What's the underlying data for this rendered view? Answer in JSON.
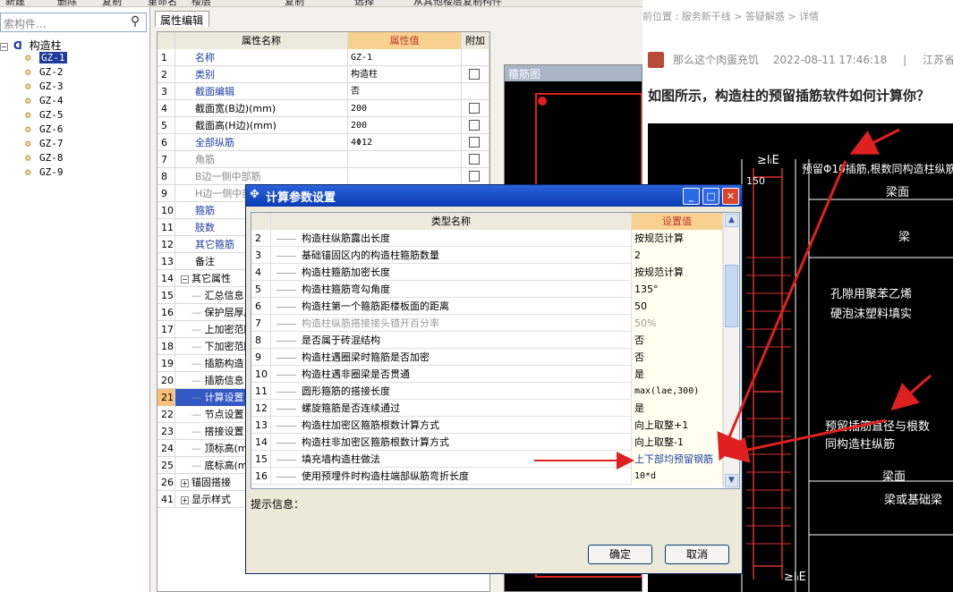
{
  "toolbar": {
    "items": [
      "新建",
      "删除",
      "复制",
      "重命名",
      "楼层",
      "",
      "复制",
      "选择",
      "从其他楼层复制构件"
    ]
  },
  "left_panel": {
    "search_placeholder": "索构件...",
    "tree_root_label": "构造柱",
    "tree_items": [
      "GZ-1",
      "GZ-2",
      "GZ-3",
      "GZ-4",
      "GZ-5",
      "GZ-6",
      "GZ-7",
      "GZ-8",
      "GZ-9"
    ],
    "selected_item": "GZ-1"
  },
  "property_editor": {
    "tab_label": "属性编辑",
    "headers": {
      "name": "属性名称",
      "value": "属性值",
      "add": "附加"
    },
    "rows": [
      {
        "num": "1",
        "name": "名称",
        "value": "GZ-1",
        "style": "blue",
        "checkbox": false
      },
      {
        "num": "2",
        "name": "类别",
        "value": "构造柱",
        "style": "blue",
        "checkbox": true
      },
      {
        "num": "3",
        "name": "截面编辑",
        "value": "否",
        "style": "blue",
        "checkbox": false
      },
      {
        "num": "4",
        "name": "截面宽(B边)(mm)",
        "value": "200",
        "style": "normal",
        "checkbox": true
      },
      {
        "num": "5",
        "name": "截面高(H边)(mm)",
        "value": "200",
        "style": "normal",
        "checkbox": true
      },
      {
        "num": "6",
        "name": "全部纵筋",
        "value": "4Φ12",
        "style": "blue",
        "checkbox": true
      },
      {
        "num": "7",
        "name": "角筋",
        "value": "",
        "style": "grey",
        "checkbox": true
      },
      {
        "num": "8",
        "name": "B边一侧中部筋",
        "value": "",
        "style": "grey",
        "checkbox": true
      },
      {
        "num": "9",
        "name": "H边一侧中部筋",
        "value": "",
        "style": "grey",
        "checkbox": true
      },
      {
        "num": "10",
        "name": "箍筋",
        "value": "",
        "style": "blue",
        "checkbox": false
      },
      {
        "num": "11",
        "name": "肢数",
        "value": "",
        "style": "blue",
        "checkbox": false
      },
      {
        "num": "12",
        "name": "其它箍筋",
        "value": "",
        "style": "blue",
        "checkbox": false
      },
      {
        "num": "13",
        "name": "备注",
        "value": "",
        "style": "normal",
        "checkbox": false
      },
      {
        "num": "14",
        "name": "其它属性",
        "value": "",
        "style": "group",
        "checkbox": false
      },
      {
        "num": "15",
        "name": "汇总信息",
        "value": "",
        "style": "child",
        "checkbox": false
      },
      {
        "num": "16",
        "name": "保护层厚度",
        "value": "",
        "style": "child",
        "checkbox": false
      },
      {
        "num": "17",
        "name": "上加密范围",
        "value": "",
        "style": "child",
        "checkbox": false
      },
      {
        "num": "18",
        "name": "下加密范围",
        "value": "",
        "style": "child",
        "checkbox": false
      },
      {
        "num": "19",
        "name": "插筋构造",
        "value": "",
        "style": "child",
        "checkbox": false
      },
      {
        "num": "20",
        "name": "插筋信息",
        "value": "",
        "style": "child",
        "checkbox": false
      },
      {
        "num": "21",
        "name": "计算设置",
        "value": "",
        "style": "selected",
        "checkbox": false
      },
      {
        "num": "22",
        "name": "节点设置",
        "value": "",
        "style": "child",
        "checkbox": false
      },
      {
        "num": "23",
        "name": "搭接设置",
        "value": "",
        "style": "child",
        "checkbox": false
      },
      {
        "num": "24",
        "name": "顶标高(m)",
        "value": "",
        "style": "child",
        "checkbox": false
      },
      {
        "num": "25",
        "name": "底标高(m)",
        "value": "",
        "style": "child",
        "checkbox": false
      },
      {
        "num": "26",
        "name": "锚固搭接",
        "value": "",
        "style": "group",
        "checkbox": false
      },
      {
        "num": "41",
        "name": "显示样式",
        "value": "",
        "style": "group",
        "checkbox": false
      }
    ]
  },
  "rebar_panel": {
    "title": "箍筋图"
  },
  "web": {
    "breadcrumb": "前位置 : 服务新干线 > 答疑解惑 > 详情",
    "user": "那么这个肉蛋充饥",
    "datetime": "2022-08-11 17:46:18",
    "separator": "|",
    "location": "江苏省",
    "question": "如图所示，构造柱的预留插筋软件如何计算你？",
    "drawing_labels": [
      "≥lₗE",
      "150",
      "预留Φ10插筋,根数同构造柱纵筋",
      "梁面",
      "梁",
      "孔隙用聚苯乙烯",
      "硬泡沫塑料填实",
      "预留插筋直径与根数",
      "同构造柱纵筋",
      "梁面",
      "梁或基础梁",
      "≥lₗE"
    ]
  },
  "dialog": {
    "title": "计算参数设置",
    "headers": {
      "name": "类型名称",
      "value": "设置值"
    },
    "rows": [
      {
        "num": "2",
        "name": "构造柱纵筋露出长度",
        "value": "按规范计算",
        "muted": false
      },
      {
        "num": "3",
        "name": "基础锚固区内的构造柱箍筋数量",
        "value": "2",
        "muted": false
      },
      {
        "num": "4",
        "name": "构造柱箍筋加密长度",
        "value": "按规范计算",
        "muted": false
      },
      {
        "num": "5",
        "name": "构造柱箍筋弯勾角度",
        "value": "135°",
        "muted": false
      },
      {
        "num": "6",
        "name": "构造柱第一个箍筋距楼板面的距离",
        "value": "50",
        "muted": false
      },
      {
        "num": "7",
        "name": "构造柱纵筋搭接接头错开百分率",
        "value": "50%",
        "muted": true
      },
      {
        "num": "8",
        "name": "是否属于砖混结构",
        "value": "否",
        "muted": false
      },
      {
        "num": "9",
        "name": "构造柱遇圈梁时箍筋是否加密",
        "value": "否",
        "muted": false
      },
      {
        "num": "10",
        "name": "构造柱遇非圈梁是否贯通",
        "value": "是",
        "muted": false
      },
      {
        "num": "11",
        "name": "圆形箍筋的搭接长度",
        "value": "max(lae,300)",
        "muted": false
      },
      {
        "num": "12",
        "name": "螺旋箍筋是否连续通过",
        "value": "是",
        "muted": false
      },
      {
        "num": "13",
        "name": "构造柱加密区箍筋根数计算方式",
        "value": "向上取整+1",
        "muted": false
      },
      {
        "num": "14",
        "name": "构造柱非加密区箍筋根数计算方式",
        "value": "向上取整-1",
        "muted": false
      },
      {
        "num": "15",
        "name": "填充墙构造柱做法",
        "value": "上下部均预留钢筋",
        "muted": false
      },
      {
        "num": "16",
        "name": "使用预埋件时构造柱端部纵筋弯折长度",
        "value": "10*d",
        "muted": false
      }
    ],
    "hint_label": "提示信息：",
    "ok_label": "确定",
    "cancel_label": "取消"
  },
  "colors": {
    "arrow": "#e02020",
    "selection": "#3359c4",
    "value_header": "#f8d08f"
  }
}
